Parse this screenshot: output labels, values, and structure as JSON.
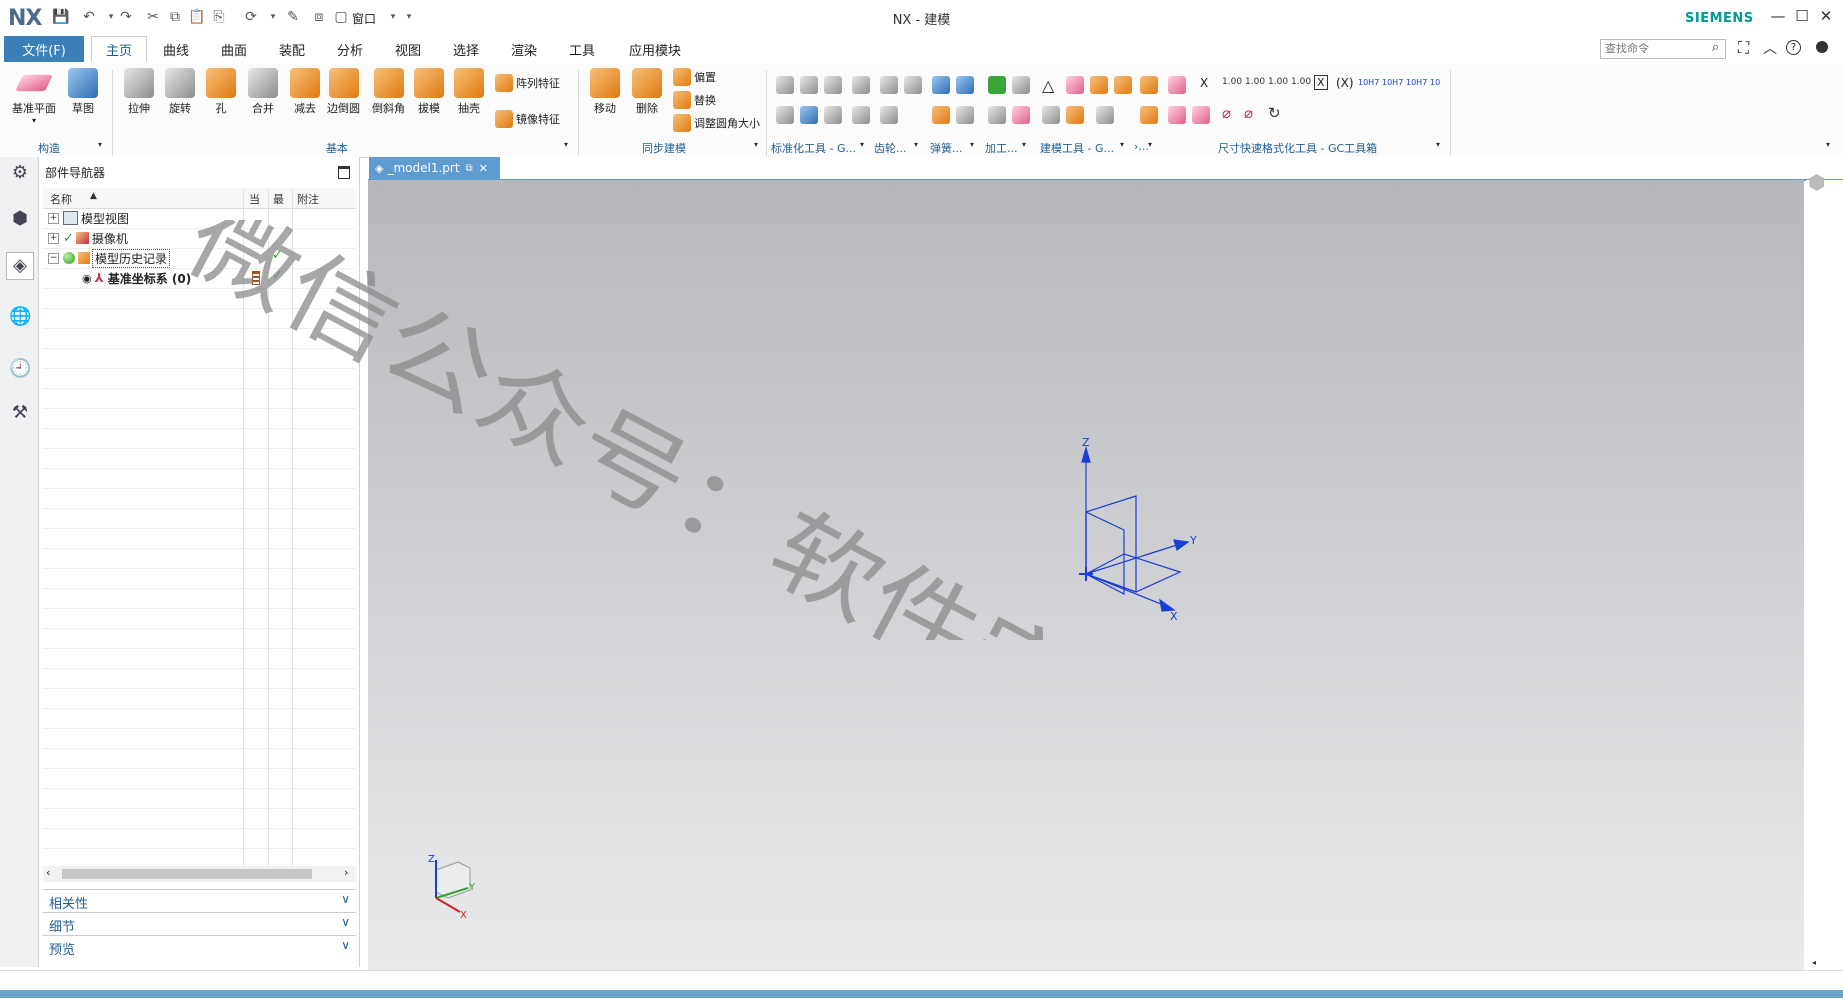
{
  "window": {
    "logo": "NX",
    "title": "NX - 建模",
    "brand": "SIEMENS",
    "window_menu": "窗口"
  },
  "menu": {
    "file": "文件(F)",
    "tabs": [
      "主页",
      "曲线",
      "曲面",
      "装配",
      "分析",
      "视图",
      "选择",
      "渲染",
      "工具",
      "应用模块"
    ],
    "active": "主页",
    "search_placeholder": "查找命令"
  },
  "ribbon": {
    "construct": {
      "datum_plane": "基准平面",
      "sketch": "草图",
      "group": "构造"
    },
    "basic": {
      "buttons": [
        "拉伸",
        "旋转",
        "孔",
        "合并",
        "减去",
        "边倒圆",
        "倒斜角",
        "拔模",
        "抽壳"
      ],
      "pattern": "阵列特征",
      "mirror": "镜像特征",
      "group": "基本"
    },
    "sync": {
      "move": "移动",
      "delete": "删除",
      "offset": "偏置",
      "replace": "替换",
      "resize_blend": "调整圆角大小",
      "group": "同步建模"
    },
    "groups_right": [
      "标准化工具 - G...",
      "齿轮...",
      "弹簧...",
      "加工...",
      "建模工具 - G...",
      "›..."
    ],
    "gc_group": "尺寸快速格式化工具 - GC工具箱",
    "gc_labels": [
      "X",
      "1.00",
      "1.00",
      "1.00",
      "1.00",
      "X",
      "(X)",
      "10H7",
      "10H7",
      "10H7",
      "10"
    ]
  },
  "navigator": {
    "title": "部件导航器",
    "columns": [
      "名称",
      "当",
      "最",
      "附注"
    ],
    "rows": [
      {
        "label": "模型视图",
        "expander": "+"
      },
      {
        "label": "摄像机",
        "expander": "+"
      },
      {
        "label": "模型历史记录",
        "expander": "−"
      },
      {
        "label": "基准坐标系 (0)",
        "expander": ""
      }
    ],
    "panels": [
      "相关性",
      "细节",
      "预览"
    ]
  },
  "document": {
    "tab": "_model1.prt"
  },
  "csys": {
    "x": "X",
    "y": "Y",
    "z": "Z"
  },
  "watermark": "微信公众号：软件安装大神",
  "colors": {
    "accent": "#3a7fb8",
    "tab_blue": "#5d9bd1",
    "brand": "#009999",
    "axis": "#1a3fd6"
  }
}
